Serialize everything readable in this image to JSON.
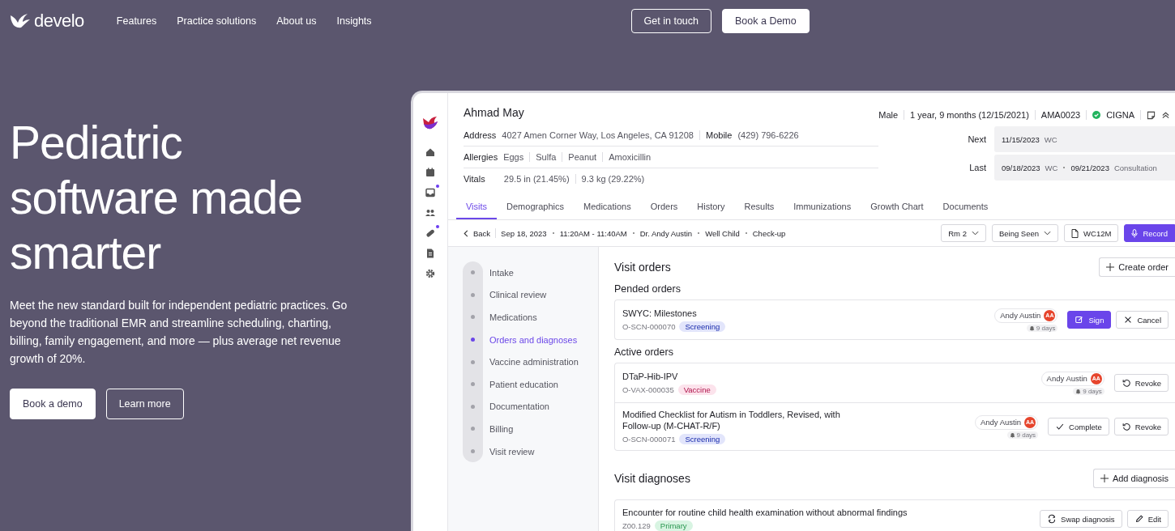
{
  "nav": {
    "logo": "develo",
    "links": [
      "Features",
      "Practice solutions",
      "About us",
      "Insights"
    ],
    "buttons": [
      {
        "label": "Get in touch",
        "kind": "outline"
      },
      {
        "label": "Book a Demo",
        "kind": "solid"
      }
    ]
  },
  "hero": {
    "title": "Pediatric software made smarter",
    "body": "Meet the new standard built for independent pediatric practices. Go beyond the traditional EMR and streamline scheduling, charting, billing, family engagement, and more — plus average net revenue growth of 20%.",
    "buttons": [
      {
        "label": "Book a demo",
        "kind": "solid"
      },
      {
        "label": "Learn more",
        "kind": "outline"
      }
    ]
  },
  "app": {
    "rail": [
      {
        "kind": "home",
        "dot": false
      },
      {
        "kind": "calendar",
        "dot": false
      },
      {
        "kind": "inbox",
        "dot": true
      },
      {
        "kind": "people",
        "dot": false
      },
      {
        "kind": "pill",
        "dot": true
      },
      {
        "kind": "document",
        "dot": false
      },
      {
        "kind": "gear",
        "dot": false
      }
    ],
    "patient": {
      "name": "Ahmad May",
      "meta": [
        "Male",
        "1 year, 9 months (12/15/2021)",
        "AMA0023"
      ],
      "insurance": {
        "label": "CIGNA",
        "verified": true
      },
      "address_label": "Address",
      "address": "4027 Amen Corner Way, Los Angeles, CA 91208",
      "mobile_label": "Mobile",
      "mobile": "(429) 796-6226",
      "allergies_label": "Allergies",
      "allergies": [
        "Eggs",
        "Sulfa",
        "Peanut",
        "Amoxicillin"
      ],
      "vitals_label": "Vitals",
      "vitals": [
        "29.5 in (21.45%)",
        "9.3 kg (29.22%)"
      ],
      "next": {
        "label": "Next",
        "visits": [
          {
            "date": "11/15/2023",
            "type": "WC"
          }
        ]
      },
      "last": {
        "label": "Last",
        "visits": [
          {
            "date": "09/18/2023",
            "type": "WC"
          },
          {
            "date": "09/21/2023",
            "type": "Consultation"
          }
        ]
      }
    },
    "tabs": [
      {
        "label": "Visits",
        "selected": true
      },
      {
        "label": "Demographics",
        "selected": false
      },
      {
        "label": "Medications",
        "selected": false
      },
      {
        "label": "Orders",
        "selected": false
      },
      {
        "label": "History",
        "selected": false
      },
      {
        "label": "Results",
        "selected": false
      },
      {
        "label": "Immunizations",
        "selected": false
      },
      {
        "label": "Growth Chart",
        "selected": false
      },
      {
        "label": "Documents",
        "selected": false
      }
    ],
    "visit_bar": {
      "back": "Back",
      "info": [
        "Sep 18, 2023",
        "11:20AM - 11:40AM",
        "Dr. Andy Austin",
        "Well Child",
        "Check-up"
      ],
      "controls": [
        {
          "label": "Rm 2",
          "kind": "dropdown"
        },
        {
          "label": "Being Seen",
          "kind": "dropdown"
        },
        {
          "label": "WC12M",
          "kind": "document"
        },
        {
          "label": "Record",
          "kind": "record"
        }
      ]
    },
    "steps": [
      {
        "label": "Intake",
        "selected": false
      },
      {
        "label": "Clinical review",
        "selected": false
      },
      {
        "label": "Medications",
        "selected": false
      },
      {
        "label": "Orders and diagnoses",
        "selected": true
      },
      {
        "label": "Vaccine administration",
        "selected": false
      },
      {
        "label": "Patient education",
        "selected": false
      },
      {
        "label": "Documentation",
        "selected": false
      },
      {
        "label": "Billing",
        "selected": false
      },
      {
        "label": "Visit review",
        "selected": false
      }
    ],
    "orders": {
      "title": "Visit orders",
      "add": "Create order",
      "groups": [
        {
          "title": "Pended orders",
          "items": [
            {
              "title": "SWYC: Milestones",
              "code": "O-SCN-000070",
              "tag": {
                "label": "Screening",
                "color": "#e2e5fb"
              },
              "provider": "Andy Austin",
              "initials": "AA",
              "age": "9 days",
              "actions": [
                {
                  "label": "Sign",
                  "kind": "sign"
                },
                {
                  "label": "Cancel",
                  "kind": "cancel"
                }
              ]
            }
          ]
        },
        {
          "title": "Active orders",
          "items": [
            {
              "title": "DTaP-Hib-IPV",
              "code": "O-VAX-000035",
              "tag": {
                "label": "Vaccine",
                "color": "#fce3ec"
              },
              "provider": "Andy Austin",
              "initials": "AA",
              "age": "9 days",
              "actions": [
                {
                  "label": "Revoke",
                  "kind": "revoke"
                }
              ]
            },
            {
              "title": "Modified Checklist for Autism in Toddlers, Revised, with Follow-up (M-CHAT-R/F)",
              "code": "O-SCN-000071",
              "tag": {
                "label": "Screening",
                "color": "#e2e5fb"
              },
              "provider": "Andy Austin",
              "initials": "AA",
              "age": "9 days",
              "actions": [
                {
                  "label": "Complete",
                  "kind": "complete"
                },
                {
                  "label": "Revoke",
                  "kind": "revoke"
                }
              ]
            }
          ]
        }
      ]
    },
    "diagnoses": {
      "title": "Visit diagnoses",
      "add": "Add diagnosis",
      "items": [
        {
          "title": "Encounter for routine child health examination without abnormal findings",
          "code": "Z00.129",
          "tag": {
            "label": "Primary",
            "color": "#d8f4e2"
          },
          "actions": [
            {
              "label": "Swap diagnosis",
              "kind": "swap"
            },
            {
              "label": "Edit",
              "kind": "edit"
            }
          ]
        }
      ]
    }
  }
}
